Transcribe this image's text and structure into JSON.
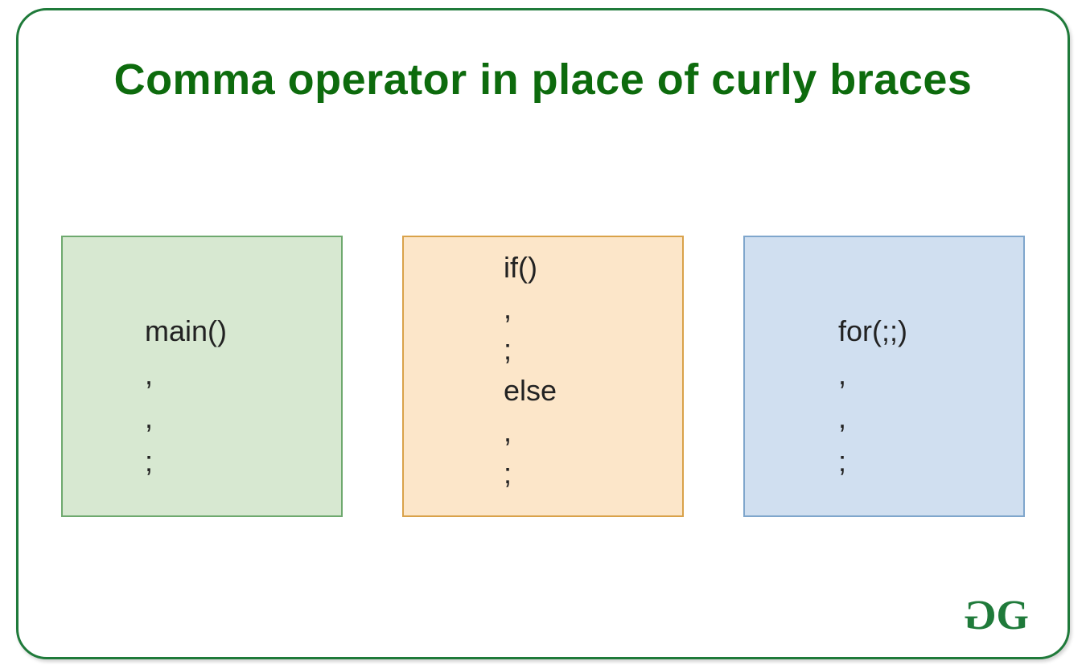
{
  "title": "Comma operator in place of curly braces",
  "boxes": {
    "main": {
      "lines": [
        "main()",
        ",",
        ",",
        ";"
      ]
    },
    "ifelse": {
      "lines": [
        "if()",
        ",",
        ";",
        "else",
        ",",
        ";"
      ]
    },
    "for": {
      "lines": [
        "for(;;)",
        ",",
        ",",
        ";"
      ]
    }
  },
  "logo": {
    "left_glyph": "G",
    "right_glyph": "G"
  },
  "colors": {
    "accent_green": "#1f7a3a",
    "title_green": "#0d6b0d",
    "box_green_fill": "#d7e8d1",
    "box_green_border": "#6ea96e",
    "box_orange_fill": "#fce6c9",
    "box_orange_border": "#d9a24a",
    "box_blue_fill": "#d0dff0",
    "box_blue_border": "#7fa6cc"
  }
}
